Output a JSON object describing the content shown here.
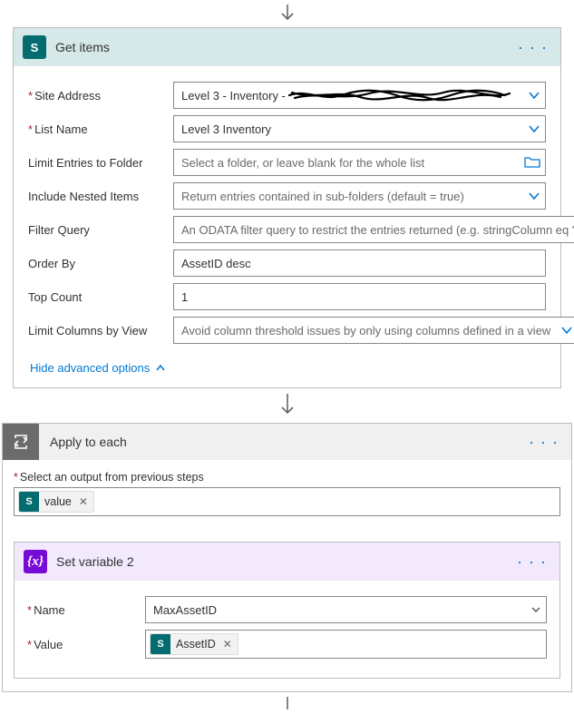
{
  "arrow": "↓",
  "getItems": {
    "title": "Get items",
    "iconText": "S",
    "fields": {
      "siteAddress": {
        "label": "Site Address",
        "value": "Level 3 - Inventory -",
        "required": true
      },
      "listName": {
        "label": "List Name",
        "value": "Level 3 Inventory",
        "required": true
      },
      "limitFolder": {
        "label": "Limit Entries to Folder",
        "placeholder": "Select a folder, or leave blank for the whole list",
        "required": false
      },
      "nested": {
        "label": "Include Nested Items",
        "placeholder": "Return entries contained in sub-folders (default = true)",
        "required": false
      },
      "filter": {
        "label": "Filter Query",
        "placeholder": "An ODATA filter query to restrict the entries returned (e.g. stringColumn eq 'stri",
        "required": false
      },
      "orderBy": {
        "label": "Order By",
        "value": "AssetID desc",
        "required": false
      },
      "topCount": {
        "label": "Top Count",
        "value": "1",
        "required": false
      },
      "limitCols": {
        "label": "Limit Columns by View",
        "placeholder": "Avoid column threshold issues by only using columns defined in a view",
        "required": false
      }
    },
    "advancedLink": "Hide advanced options"
  },
  "applyToEach": {
    "title": "Apply to each",
    "selectLabel": "Select an output from previous steps",
    "tokenLabel": "value",
    "tokenIcon": "S"
  },
  "setVariable": {
    "title": "Set variable 2",
    "iconText": "{x}",
    "nameLabel": "Name",
    "nameValue": "MaxAssetID",
    "valueLabel": "Value",
    "valueTokenLabel": "AssetID",
    "valueTokenIcon": "S"
  }
}
